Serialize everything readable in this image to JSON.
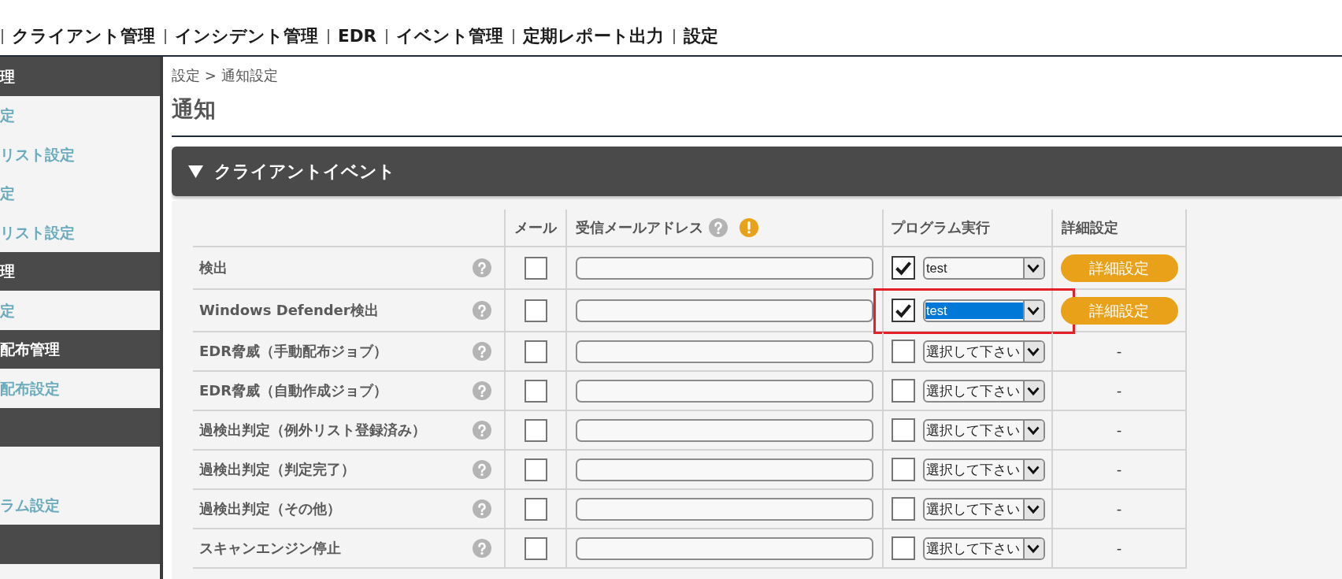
{
  "top_nav": [
    "クライアント管理",
    "インシデント管理",
    "EDR",
    "イベント管理",
    "定期レポート出力",
    "設定"
  ],
  "sidebar": {
    "items": [
      {
        "kind": "heading",
        "label": "理"
      },
      {
        "kind": "link",
        "label": "定"
      },
      {
        "kind": "link",
        "label": "リスト設定"
      },
      {
        "kind": "link",
        "label": "定"
      },
      {
        "kind": "link",
        "label": "リスト設定"
      },
      {
        "kind": "heading",
        "label": "理"
      },
      {
        "kind": "link",
        "label": "定"
      },
      {
        "kind": "heading",
        "label": "配布管理"
      },
      {
        "kind": "link",
        "label": "配布設定"
      },
      {
        "kind": "heading"
      },
      {
        "kind": "blank"
      },
      {
        "kind": "link",
        "label": "ラム設定"
      },
      {
        "kind": "heading"
      }
    ]
  },
  "breadcrumb": "設定 > 通知設定",
  "page_title": "通知",
  "section": {
    "title": "クライアントイベント",
    "expanded": true,
    "columns": [
      {
        "kind": "plain",
        "label": "メール"
      },
      {
        "kind": "hinted",
        "label": "受信メールアドレス"
      },
      {
        "kind": "plain",
        "label": "プログラム実行"
      },
      {
        "kind": "plain",
        "label": "詳細設定"
      }
    ],
    "rows": [
      {
        "label": "検出",
        "mail_checked": false,
        "program_checked": true,
        "program": {
          "value": "test",
          "focused": false
        },
        "detail": {
          "kind": "button",
          "label": "詳細設定"
        },
        "annotated": false
      },
      {
        "label": "Windows Defender検出",
        "mail_checked": false,
        "program_checked": true,
        "program": {
          "value": "test",
          "focused": true
        },
        "detail": {
          "kind": "button",
          "label": "詳細設定"
        },
        "annotated": true
      },
      {
        "label": "EDR脅威（手動配布ジョブ）",
        "mail_checked": false,
        "program_checked": false,
        "program": {
          "value": "選択して下さい",
          "focused": false
        },
        "detail": {
          "kind": "text",
          "label": "-"
        },
        "annotated": false
      },
      {
        "label": "EDR脅威（自動作成ジョブ）",
        "mail_checked": false,
        "program_checked": false,
        "program": {
          "value": "選択して下さい",
          "focused": false
        },
        "detail": {
          "kind": "text",
          "label": "-"
        },
        "annotated": false
      },
      {
        "label": "過検出判定（例外リスト登録済み）",
        "mail_checked": false,
        "program_checked": false,
        "program": {
          "value": "選択して下さい",
          "focused": false
        },
        "detail": {
          "kind": "text",
          "label": "-"
        },
        "annotated": false
      },
      {
        "label": "過検出判定（判定完了）",
        "mail_checked": false,
        "program_checked": false,
        "program": {
          "value": "選択して下さい",
          "focused": false
        },
        "detail": {
          "kind": "text",
          "label": "-"
        },
        "annotated": false
      },
      {
        "label": "過検出判定（その他）",
        "mail_checked": false,
        "program_checked": false,
        "program": {
          "value": "選択して下さい",
          "focused": false
        },
        "detail": {
          "kind": "text",
          "label": "-"
        },
        "annotated": false
      },
      {
        "label": "スキャンエンジン停止",
        "mail_checked": false,
        "program_checked": false,
        "program": {
          "value": "選択して下さい",
          "focused": false
        },
        "detail": {
          "kind": "text",
          "label": "-"
        },
        "annotated": false
      }
    ]
  }
}
